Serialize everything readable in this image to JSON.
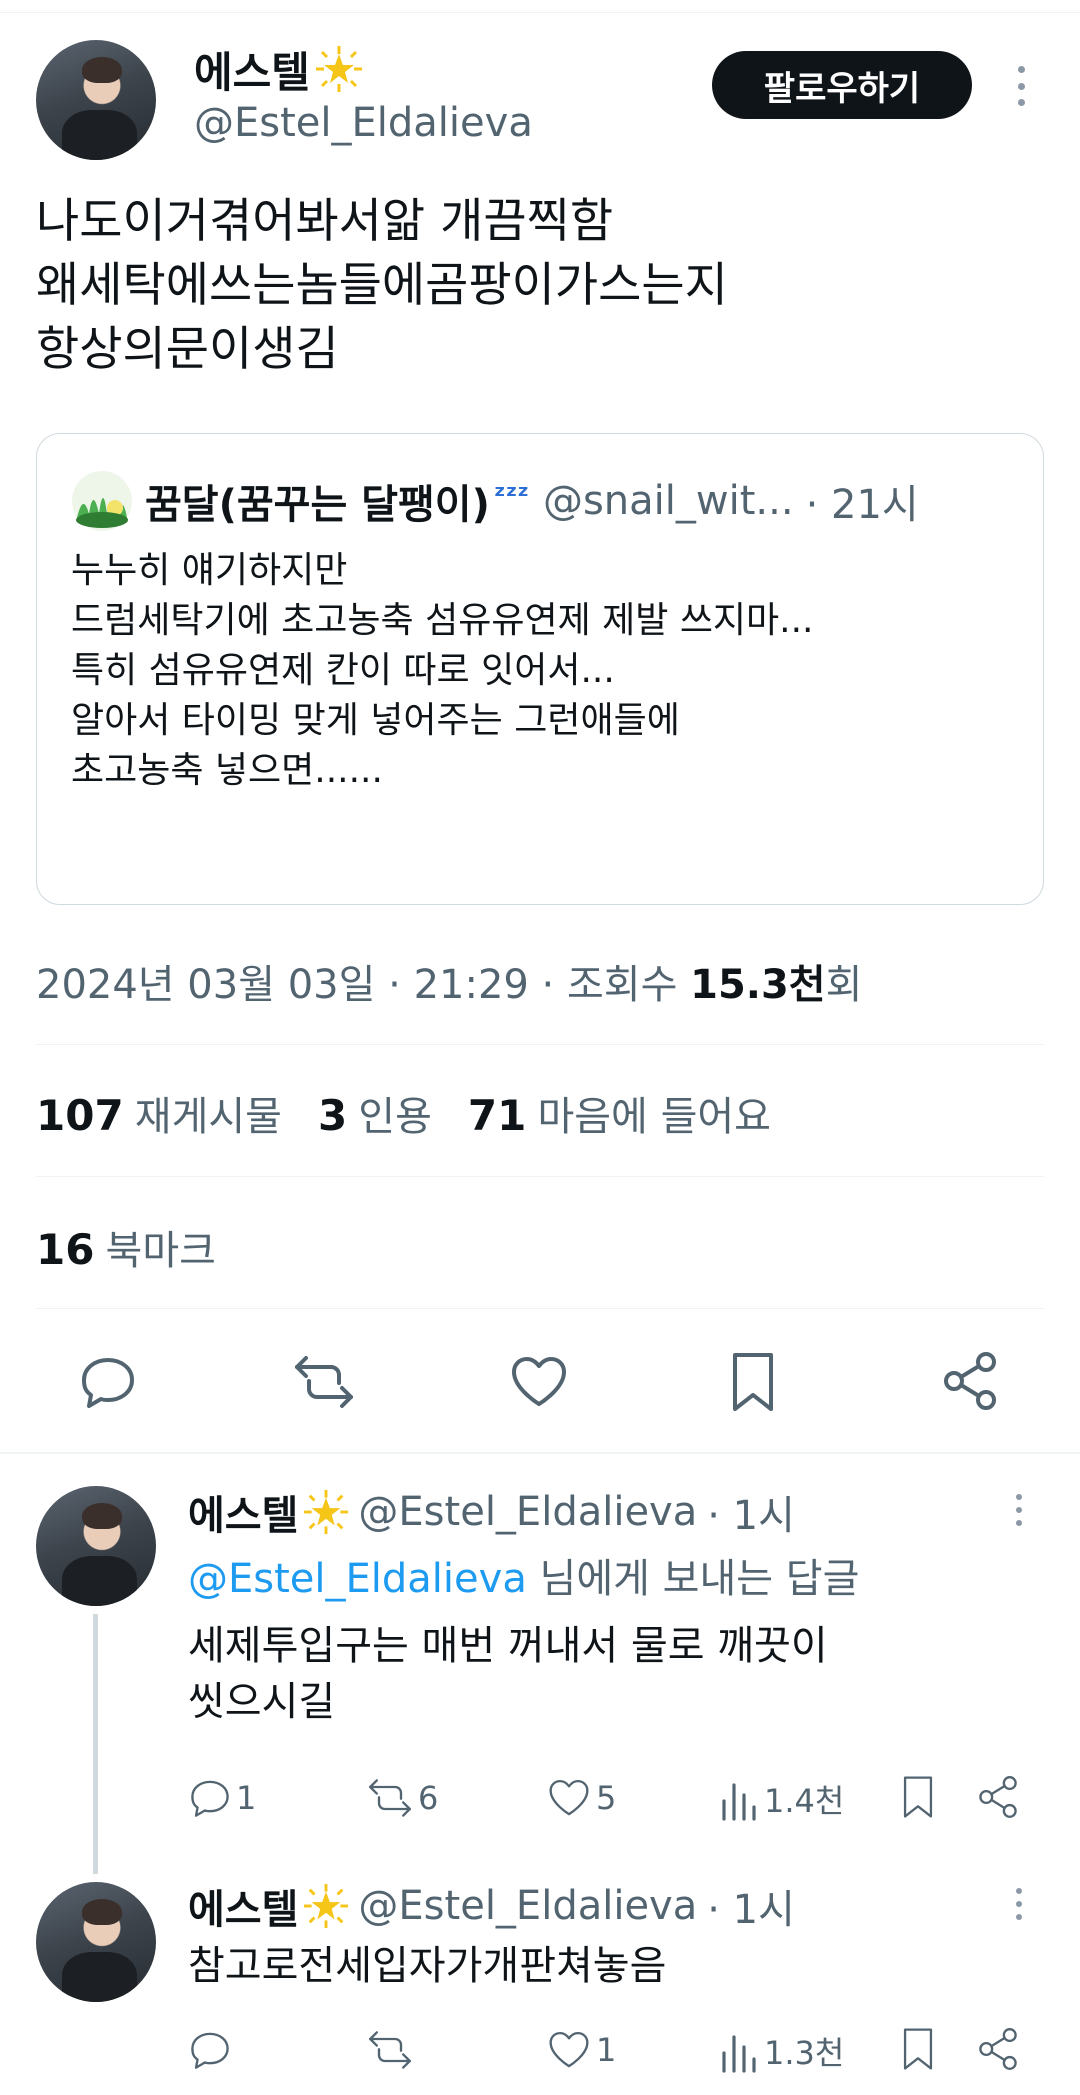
{
  "tweet": {
    "author_name": "에스텔",
    "author_handle": "@Estel_Eldalieva",
    "follow_label": "팔로우하기",
    "text": "나도이거겪어봐서앎 개끔찍함\n왜세탁에쓰는놈들에곰팡이가스는지\n항상의문이생김",
    "timestamp": "2024년 03월 03일 · 21:29 · 조회수 ",
    "views_value": "15.3천",
    "views_suffix": "회"
  },
  "quote": {
    "author_name": "꿈달(꿈꾸는 달팽이)",
    "author_handle": "@snail_wit...",
    "time": "· 21시",
    "text": "누누히 얘기하지만\n드럼세탁기에 초고농축 섬유유연제 제발 쓰지마...\n특히 섬유유연제 칸이 따로 잇어서...\n알아서 타이밍 맞게 넣어주는 그런애들에\n초고농축 넣으면......"
  },
  "stats": {
    "reposts_count": "107",
    "reposts_label": "재게시물",
    "quotes_count": "3",
    "quotes_label": "인용",
    "likes_count": "71",
    "likes_label": "마음에 들어요",
    "bookmarks_count": "16",
    "bookmarks_label": "북마크"
  },
  "icons": {
    "reply": "reply-icon",
    "repost": "repost-icon",
    "like": "heart-icon",
    "bookmark": "bookmark-icon",
    "share": "share-icon",
    "views": "views-icon"
  },
  "replies": [
    {
      "author_name": "에스텔",
      "author_handle": "@Estel_Eldalieva",
      "time": "· 1시",
      "replying_to_handle": "@Estel_Eldalieva",
      "replying_to_suffix": " 님에게 보내는 답글",
      "text": "세제투입구는 매번 꺼내서 물로 깨끗이\n씻으시길",
      "reply_count": "1",
      "repost_count": "6",
      "like_count": "5",
      "view_count": "1.4천"
    },
    {
      "author_name": "에스텔",
      "author_handle": "@Estel_Eldalieva",
      "time": "· 1시",
      "text": "참고로전세입자가개판쳐놓음",
      "reply_count": "",
      "repost_count": "",
      "like_count": "1",
      "view_count": "1.3천"
    }
  ],
  "colors": {
    "text": "#0f1419",
    "secondary": "#536471",
    "link": "#1d9bf0",
    "star": "#f5c518"
  }
}
